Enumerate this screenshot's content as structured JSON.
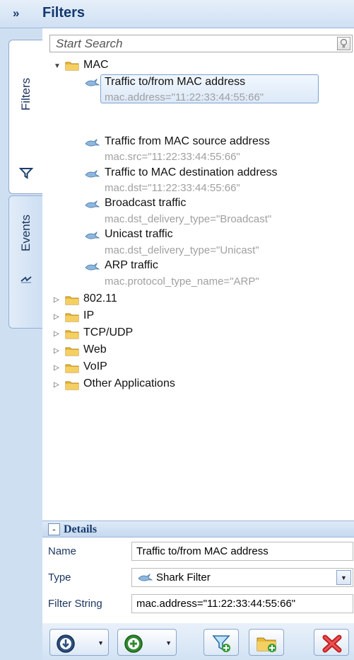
{
  "header": {
    "title": "Filters",
    "collapse_glyph": "»"
  },
  "tabs": [
    {
      "label": "Filters",
      "icon": "funnel-icon",
      "active": true
    },
    {
      "label": "Events",
      "icon": "event-icon",
      "active": false
    }
  ],
  "search": {
    "placeholder": "Start Search",
    "value": ""
  },
  "tree": {
    "mac_group": {
      "label": "MAC",
      "expanded": true,
      "filters": [
        {
          "title": "Traffic to/from MAC address",
          "expr": "mac.address=\"11:22:33:44:55:66\"",
          "selected": true
        },
        {
          "title": "Traffic from MAC source address",
          "expr": "mac.src=\"11:22:33:44:55:66\""
        },
        {
          "title": "Traffic to MAC destination address",
          "expr": "mac.dst=\"11:22:33:44:55:66\""
        },
        {
          "title": "Broadcast traffic",
          "expr": "mac.dst_delivery_type=\"Broadcast\""
        },
        {
          "title": "Unicast traffic",
          "expr": "mac.dst_delivery_type=\"Unicast\""
        },
        {
          "title": "ARP traffic",
          "expr": "mac.protocol_type_name=\"ARP\""
        }
      ]
    },
    "groups": [
      "802.11",
      "IP",
      "TCP/UDP",
      "Web",
      "VoIP",
      "Other Applications"
    ]
  },
  "details": {
    "title": "Details",
    "name_label": "Name",
    "name_value": "Traffic to/from MAC address",
    "type_label": "Type",
    "type_value": "Shark Filter",
    "filter_label": "Filter String",
    "filter_value": "mac.address=\"11:22:33:44:55:66\""
  },
  "colors": {
    "header_text": "#13386f",
    "selection_border": "#7da2ce",
    "expression_gray": "#a0a0a0",
    "folder": "#e8b93a"
  }
}
